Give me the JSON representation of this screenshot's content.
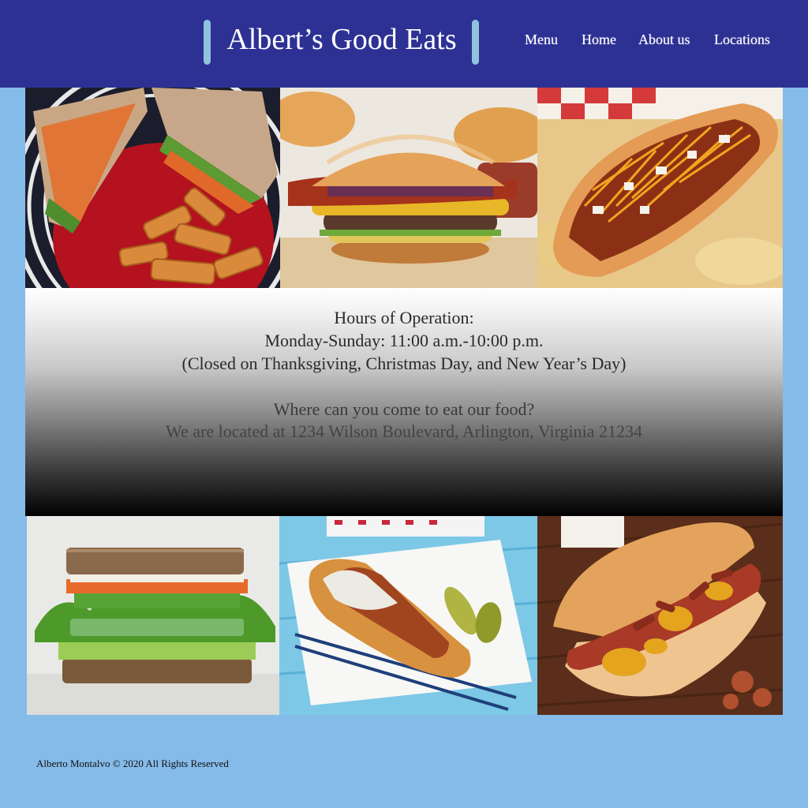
{
  "header": {
    "title": "Albert’s Good Eats",
    "nav": [
      "Menu",
      "Home",
      "About us",
      "Locations"
    ],
    "background_color": "#2d3194",
    "accent_color": "#8fc3dc"
  },
  "gallery": {
    "top": [
      {
        "alt": "Sandwich with fries"
      },
      {
        "alt": "Bacon cheeseburger"
      },
      {
        "alt": "Chili cheese hot dog"
      }
    ],
    "bottom": [
      {
        "alt": "Veggie sandwich"
      },
      {
        "alt": "Hot dog with pickles"
      },
      {
        "alt": "Bacon cheese hot dog"
      }
    ]
  },
  "info": {
    "hours_heading": "Hours of Operation:",
    "hours": "Monday-Sunday: 11:00 a.m.-10:00 p.m.",
    "closed": "(Closed on Thanksgiving, Christmas Day, and New Year’s Day)",
    "location_question": "Where can you come to eat our food?",
    "address": "We are located at 1234 Wilson Boulevard, Arlington, Virginia 21234"
  },
  "footer": {
    "copyright": "Alberto Montalvo © 2020 All Rights Reserved"
  },
  "page_background": "#85bbe9"
}
